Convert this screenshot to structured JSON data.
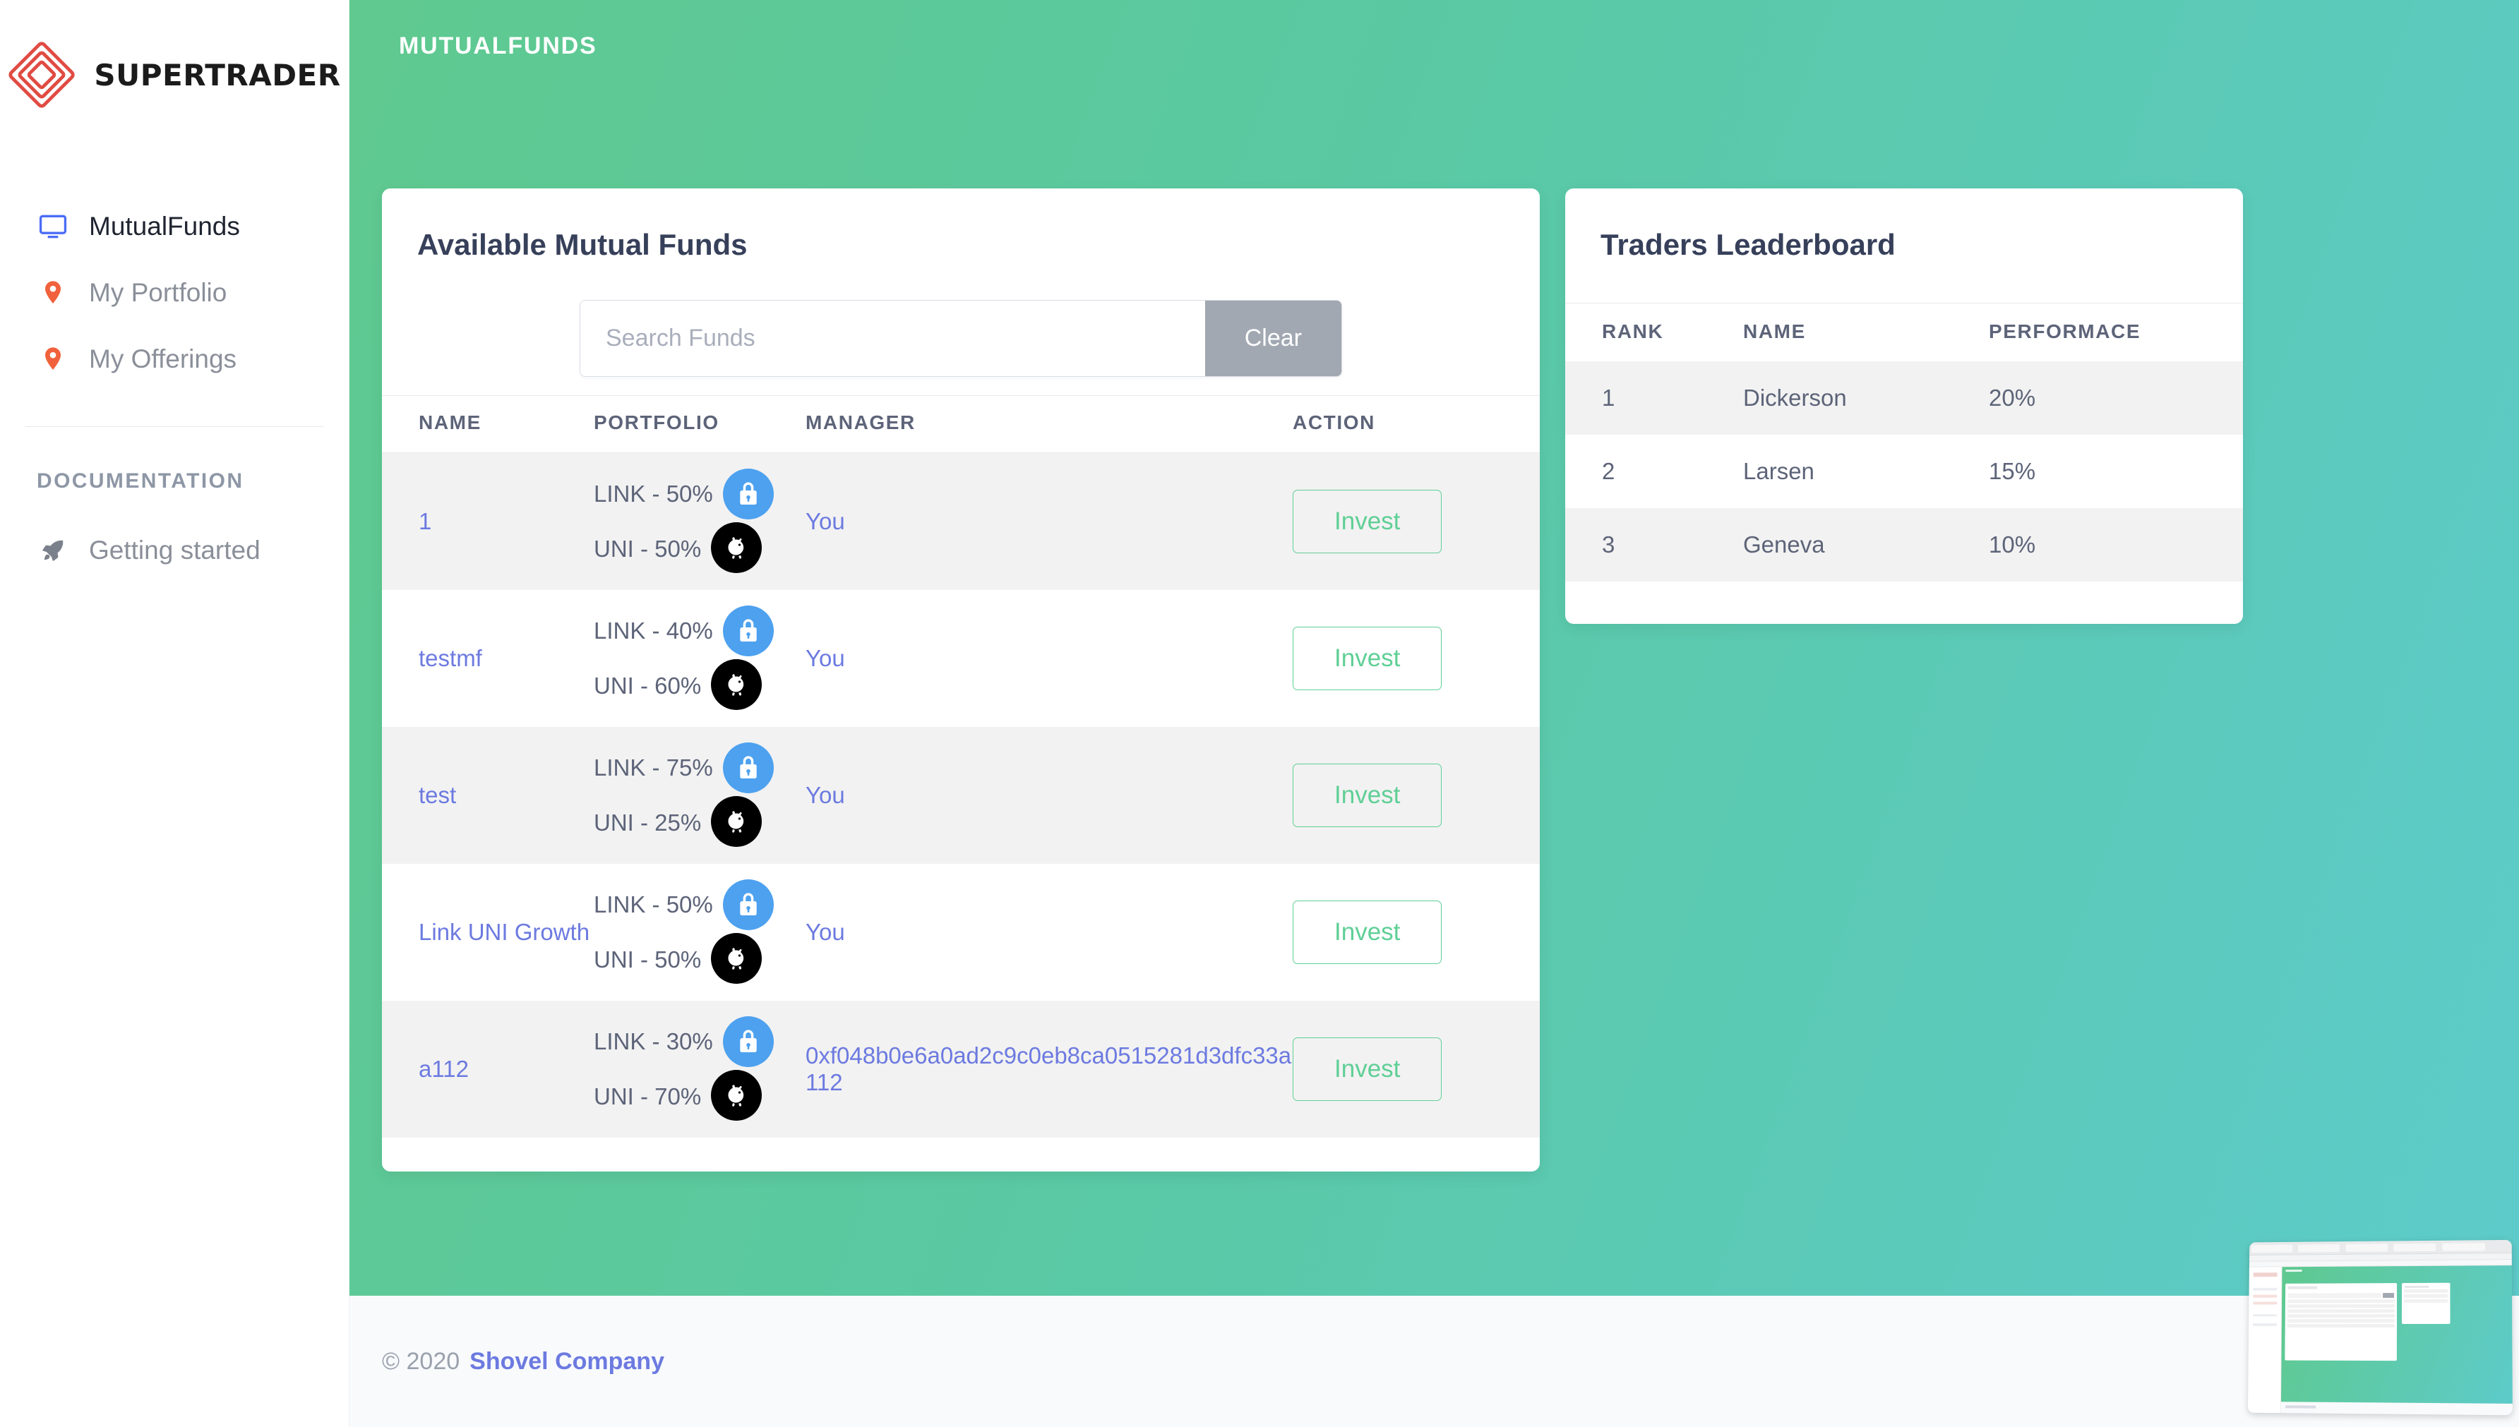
{
  "brand": {
    "name": "SUPERTRADER",
    "logo_icon": "diamond-logo-icon",
    "color": "#e04b42"
  },
  "sidebar": {
    "items": [
      {
        "label": "MutualFunds",
        "icon": "monitor-icon",
        "active": true
      },
      {
        "label": "My Portfolio",
        "icon": "map-pin-icon",
        "active": false
      },
      {
        "label": "My Offerings",
        "icon": "map-pin-icon",
        "active": false
      }
    ],
    "section_title": "DOCUMENTATION",
    "doc_items": [
      {
        "label": "Getting started",
        "icon": "rocket-icon"
      }
    ]
  },
  "header": {
    "title": "MUTUALFUNDS"
  },
  "funds_card": {
    "title": "Available Mutual Funds",
    "search": {
      "placeholder": "Search Funds",
      "value": ""
    },
    "clear_label": "Clear",
    "columns": [
      "NAME",
      "PORTFOLIO",
      "MANAGER",
      "ACTION"
    ],
    "action_label": "Invest",
    "rows": [
      {
        "name": "1",
        "alloc_link": "LINK - 50%",
        "alloc_uni": "UNI - 50%",
        "manager": "You"
      },
      {
        "name": "testmf",
        "alloc_link": "LINK - 40%",
        "alloc_uni": "UNI - 60%",
        "manager": "You"
      },
      {
        "name": "test",
        "alloc_link": "LINK - 75%",
        "alloc_uni": "UNI - 25%",
        "manager": "You"
      },
      {
        "name": "Link UNI Growth",
        "alloc_link": "LINK - 50%",
        "alloc_uni": "UNI - 50%",
        "manager": "You"
      },
      {
        "name": "a112",
        "alloc_link": "LINK - 30%",
        "alloc_uni": "UNI - 70%",
        "manager": "0xf048b0e6a0ad2c9c0eb8ca0515281d3dfc33a112"
      }
    ]
  },
  "leaderboard_card": {
    "title": "Traders Leaderboard",
    "columns": [
      "RANK",
      "NAME",
      "PERFORMACE"
    ],
    "rows": [
      {
        "rank": "1",
        "name": "Dickerson",
        "performance": "20%"
      },
      {
        "rank": "2",
        "name": "Larsen",
        "performance": "15%"
      },
      {
        "rank": "3",
        "name": "Geneva",
        "performance": "10%"
      }
    ]
  },
  "footer": {
    "copyright": "© 2020",
    "company": "Shovel Company"
  },
  "colors": {
    "gradient_start": "#5fc98f",
    "gradient_end": "#5dcbca",
    "invest_green": "#5fcf96",
    "link_blue": "#4da1ef",
    "uni_black": "#000000",
    "link_text": "#6c7ae0",
    "clear_gray": "#a2a8b2"
  }
}
